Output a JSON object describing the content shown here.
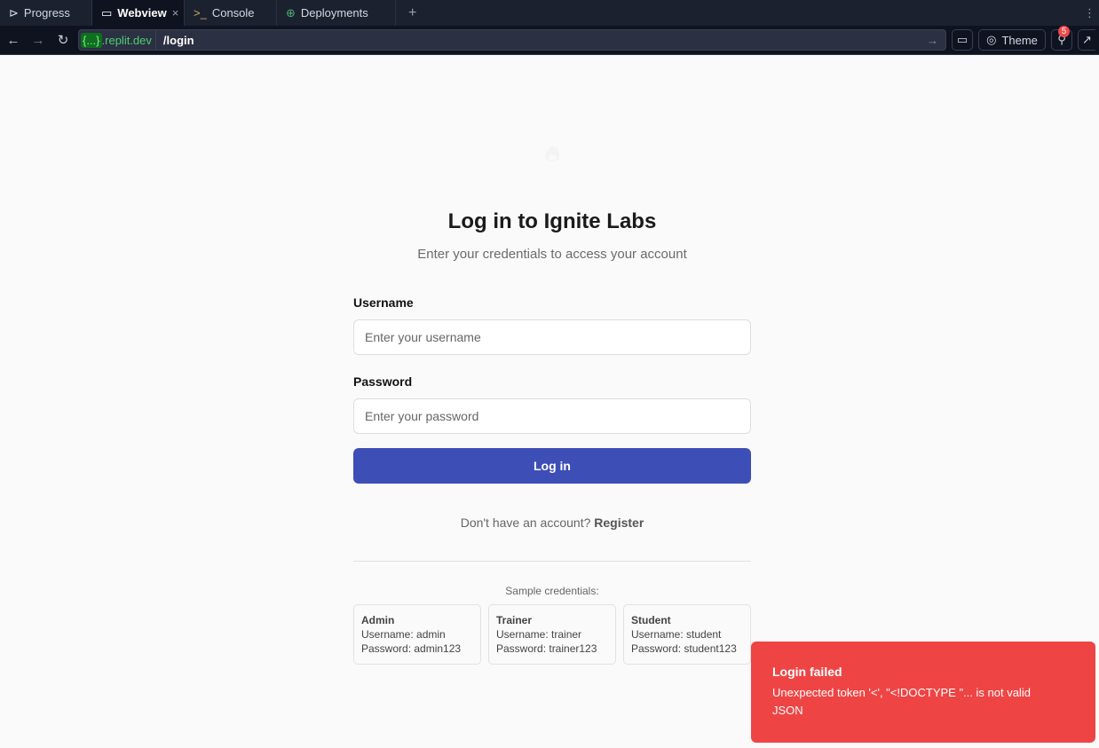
{
  "tabs": [
    {
      "label": "Progress",
      "icon": "progress-icon"
    },
    {
      "label": "Webview",
      "icon": "monitor-icon",
      "active": true
    },
    {
      "label": "Console",
      "icon": "terminal-icon"
    },
    {
      "label": "Deployments",
      "icon": "deploy-icon"
    }
  ],
  "address": {
    "host_prefix": "{...}",
    "host": ".replit.dev",
    "path": "/login"
  },
  "toolbar": {
    "theme": "Theme",
    "badge": "5"
  },
  "page": {
    "title": "Log in to Ignite Labs",
    "subtitle": "Enter your credentials to access your account",
    "username_label": "Username",
    "username_placeholder": "Enter your username",
    "password_label": "Password",
    "password_placeholder": "Enter your password",
    "login_button": "Log in",
    "register_prompt": "Don't have an account?",
    "register_link": "Register",
    "sample_title": "Sample credentials:",
    "samples": [
      {
        "role": "Admin",
        "username": "Username: admin",
        "password": "Password: admin123"
      },
      {
        "role": "Trainer",
        "username": "Username: trainer",
        "password": "Password: trainer123"
      },
      {
        "role": "Student",
        "username": "Username: student",
        "password": "Password: student123"
      }
    ]
  },
  "toast": {
    "title": "Login failed",
    "message": "Unexpected token '<', \"<!DOCTYPE \"... is not valid JSON",
    "color": "#ef4444"
  }
}
